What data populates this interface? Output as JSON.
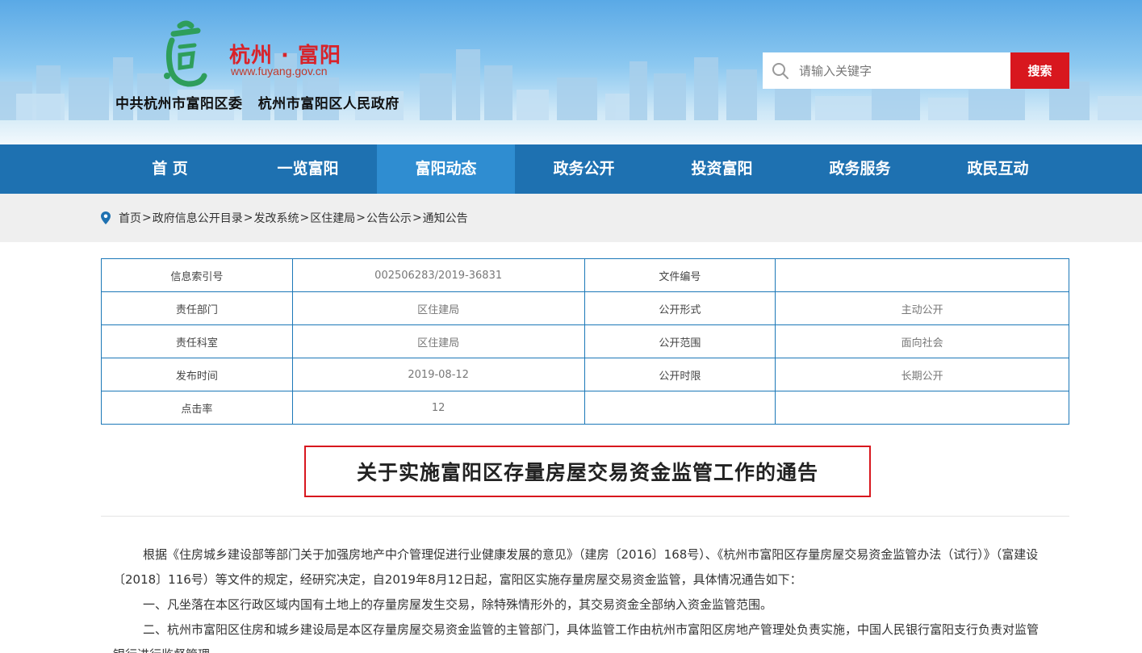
{
  "header": {
    "site_name": "杭州 · 富阳",
    "site_url": "www.fuyang.gov.cn",
    "org_name": "中共杭州市富阳区委   杭州市富阳区人民政府",
    "search_placeholder": "请输入关键字",
    "search_button": "搜索"
  },
  "nav": {
    "items": [
      {
        "label": "首 页"
      },
      {
        "label": "一览富阳"
      },
      {
        "label": "富阳动态"
      },
      {
        "label": "政务公开"
      },
      {
        "label": "投资富阳"
      },
      {
        "label": "政务服务"
      },
      {
        "label": "政民互动"
      }
    ],
    "active_index": 2
  },
  "breadcrumb": [
    "首页",
    "政府信息公开目录",
    "发改系统",
    "区住建局",
    "公告公示",
    "通知公告"
  ],
  "info_table": {
    "rows": [
      [
        "信息索引号",
        "002506283/2019-36831",
        "文件编号",
        ""
      ],
      [
        "责任部门",
        "区住建局",
        "公开形式",
        "主动公开"
      ],
      [
        "责任科室",
        "区住建局",
        "公开范围",
        "面向社会"
      ],
      [
        "发布时间",
        "2019-08-12",
        "公开时限",
        "长期公开"
      ],
      [
        "点击率",
        "12",
        "",
        ""
      ]
    ]
  },
  "article": {
    "title": "关于实施富阳区存量房屋交易资金监管工作的通告",
    "paragraphs": [
      "根据《住房城乡建设部等部门关于加强房地产中介管理促进行业健康发展的意见》（建房〔2016〕168号）、《杭州市富阳区存量房屋交易资金监管办法（试行）》（富建设〔2018〕116号）等文件的规定，经研究决定，自2019年8月12日起，富阳区实施存量房屋交易资金监管，具体情况通告如下：",
      "一、凡坐落在本区行政区域内国有土地上的存量房屋发生交易，除特殊情形外的，其交易资金全部纳入资金监管范围。",
      "二、杭州市富阳区住房和城乡建设局是本区存量房屋交易资金监管的主管部门，具体监管工作由杭州市富阳区房地产管理处负责实施，中国人民银行富阳支行负责对监管银行进行监督管理。"
    ]
  },
  "colors": {
    "nav_bg": "#1e71b1",
    "nav_active": "#2f8dd1",
    "accent_red": "#d8171e",
    "table_border": "#1c78b8"
  }
}
